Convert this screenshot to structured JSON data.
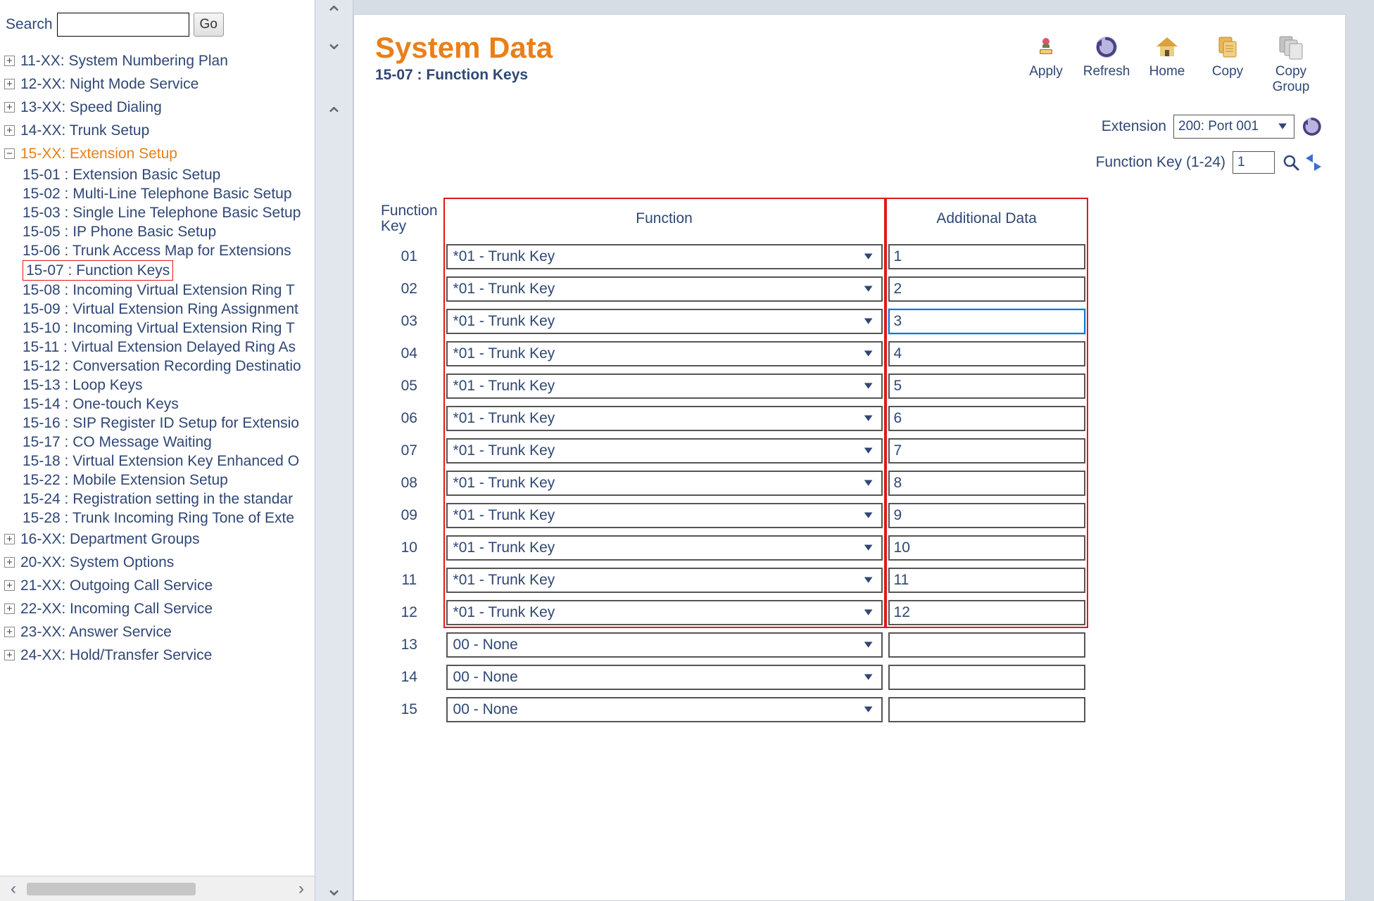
{
  "page": {
    "title": "System Data",
    "subtitle": "15-07 : Function Keys"
  },
  "search": {
    "label": "Search",
    "go": "Go"
  },
  "nav": {
    "groups_top": [
      {
        "label": "11-XX: System Numbering Plan",
        "expanded": false
      },
      {
        "label": "12-XX: Night Mode Service",
        "expanded": false
      },
      {
        "label": "13-XX: Speed Dialing",
        "expanded": false
      },
      {
        "label": "14-XX: Trunk Setup",
        "expanded": false
      }
    ],
    "group15": {
      "label": "15-XX: Extension Setup",
      "children": [
        {
          "label": "15-01 : Extension Basic Setup"
        },
        {
          "label": "15-02 : Multi-Line Telephone Basic Setup"
        },
        {
          "label": "15-03 : Single Line Telephone Basic Setup"
        },
        {
          "label": "15-05 : IP Phone Basic Setup"
        },
        {
          "label": "15-06 : Trunk Access Map for Extensions"
        },
        {
          "label": "15-07 : Function Keys",
          "selected": true
        },
        {
          "label": "15-08 : Incoming Virtual Extension Ring T"
        },
        {
          "label": "15-09 : Virtual Extension Ring Assignment"
        },
        {
          "label": "15-10 : Incoming Virtual Extension Ring T"
        },
        {
          "label": "15-11 : Virtual Extension Delayed Ring As"
        },
        {
          "label": "15-12 : Conversation Recording Destinatio"
        },
        {
          "label": "15-13 : Loop Keys"
        },
        {
          "label": "15-14 : One-touch Keys"
        },
        {
          "label": "15-16 : SIP Register ID Setup for Extensio"
        },
        {
          "label": "15-17 : CO Message Waiting"
        },
        {
          "label": "15-18 : Virtual Extension Key Enhanced O"
        },
        {
          "label": "15-22 : Mobile Extension Setup"
        },
        {
          "label": "15-24 : Registration setting in the standar"
        },
        {
          "label": "15-28 : Trunk Incoming Ring Tone of Exte"
        }
      ]
    },
    "groups_bottom": [
      {
        "label": "16-XX: Department Groups"
      },
      {
        "label": "20-XX: System Options"
      },
      {
        "label": "21-XX: Outgoing Call Service"
      },
      {
        "label": "22-XX: Incoming Call Service"
      },
      {
        "label": "23-XX: Answer Service"
      },
      {
        "label": "24-XX: Hold/Transfer Service"
      }
    ]
  },
  "toolbar": {
    "apply": {
      "label": "Apply"
    },
    "refresh": {
      "label": "Refresh"
    },
    "home": {
      "label": "Home"
    },
    "copy": {
      "label": "Copy"
    },
    "copy_group": {
      "label": "Copy Group"
    }
  },
  "filters": {
    "extension_label": "Extension",
    "extension_value": "200: Port 001",
    "fk_label": "Function Key (1-24)",
    "fk_value": "1"
  },
  "grid": {
    "headers": {
      "key": "Function Key",
      "func": "Function",
      "data": "Additional Data"
    },
    "rows": [
      {
        "key": "01",
        "func": "*01 - Trunk Key",
        "data": "1"
      },
      {
        "key": "02",
        "func": "*01 - Trunk Key",
        "data": "2"
      },
      {
        "key": "03",
        "func": "*01 - Trunk Key",
        "data": "3",
        "focused": true
      },
      {
        "key": "04",
        "func": "*01 - Trunk Key",
        "data": "4"
      },
      {
        "key": "05",
        "func": "*01 - Trunk Key",
        "data": "5"
      },
      {
        "key": "06",
        "func": "*01 - Trunk Key",
        "data": "6"
      },
      {
        "key": "07",
        "func": "*01 - Trunk Key",
        "data": "7"
      },
      {
        "key": "08",
        "func": "*01 - Trunk Key",
        "data": "8"
      },
      {
        "key": "09",
        "func": "*01 - Trunk Key",
        "data": "9"
      },
      {
        "key": "10",
        "func": "*01 - Trunk Key",
        "data": "10"
      },
      {
        "key": "11",
        "func": "*01 - Trunk Key",
        "data": "11"
      },
      {
        "key": "12",
        "func": "*01 - Trunk Key",
        "data": "12"
      },
      {
        "key": "13",
        "func": "00 - None",
        "data": ""
      },
      {
        "key": "14",
        "func": "00 - None",
        "data": ""
      },
      {
        "key": "15",
        "func": "00 - None",
        "data": ""
      }
    ],
    "highlight_rows": 12
  },
  "colors": {
    "accent": "#e8801a",
    "text": "#2f4775",
    "highlight": "#e01818"
  }
}
